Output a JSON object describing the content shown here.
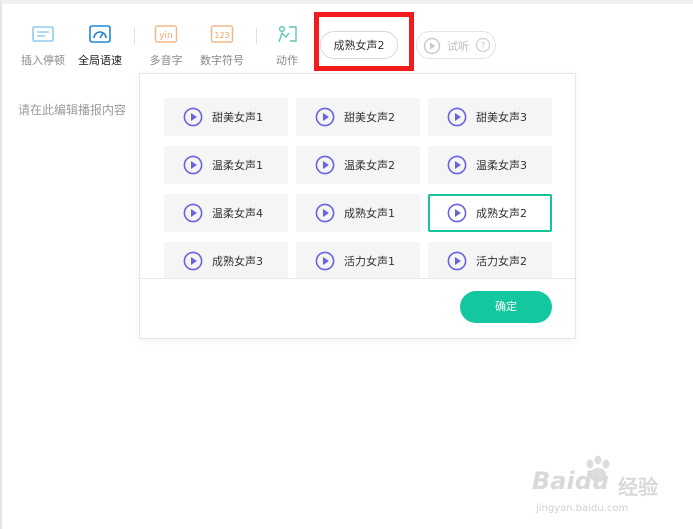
{
  "toolbar": {
    "tools": [
      {
        "label": "插入停顿",
        "icon": "pause-insert-icon"
      },
      {
        "label": "全局语速",
        "icon": "speedometer-icon"
      },
      {
        "label": "多音字",
        "icon": "yin-icon",
        "glyph": "yin"
      },
      {
        "label": "数字符号",
        "icon": "number-icon",
        "glyph": "123"
      },
      {
        "label": "动作",
        "icon": "action-icon"
      }
    ],
    "voice_selected": "成熟女声2",
    "listen_label": "试听"
  },
  "editor": {
    "placeholder": "请在此编辑播报内容"
  },
  "voices": [
    "甜美女声1",
    "甜美女声2",
    "甜美女声3",
    "温柔女声1",
    "温柔女声2",
    "温柔女声3",
    "温柔女声4",
    "成熟女声1",
    "成熟女声2",
    "成熟女声3",
    "活力女声1",
    "活力女声2"
  ],
  "selected_voice": "成熟女声2",
  "confirm_label": "确定",
  "colors": {
    "accent": "#13c79f",
    "play_icon": "#6a63e0",
    "highlight": "#f31c1c"
  },
  "watermark": {
    "brand": "Baidu",
    "cn": "经验",
    "url": "jingyan.baidu.com"
  }
}
